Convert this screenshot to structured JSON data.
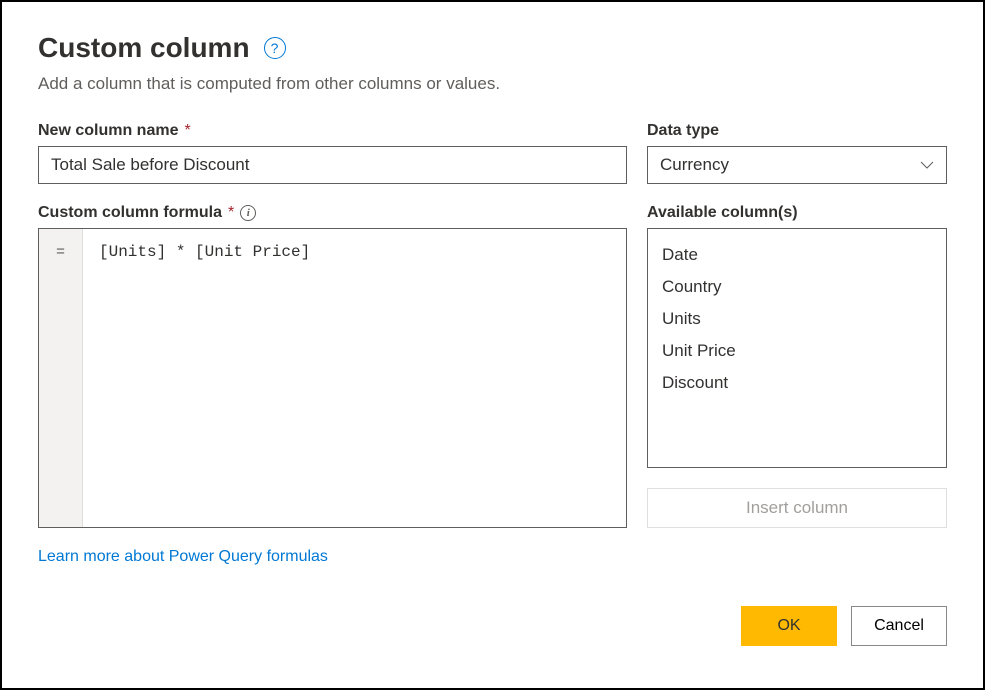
{
  "dialog": {
    "title": "Custom column",
    "subtitle": "Add a column that is computed from other columns or values."
  },
  "labels": {
    "new_column_name": "New column name",
    "data_type": "Data type",
    "formula": "Custom column formula",
    "available_columns": "Available column(s)"
  },
  "fields": {
    "column_name_value": "Total Sale before Discount",
    "data_type_value": "Currency",
    "formula_value": "[Units] * [Unit Price]",
    "gutter_symbol": "="
  },
  "available_columns": [
    "Date",
    "Country",
    "Units",
    "Unit Price",
    "Discount"
  ],
  "buttons": {
    "insert_column": "Insert column",
    "ok": "OK",
    "cancel": "Cancel"
  },
  "link": {
    "learn_more": "Learn more about Power Query formulas"
  }
}
